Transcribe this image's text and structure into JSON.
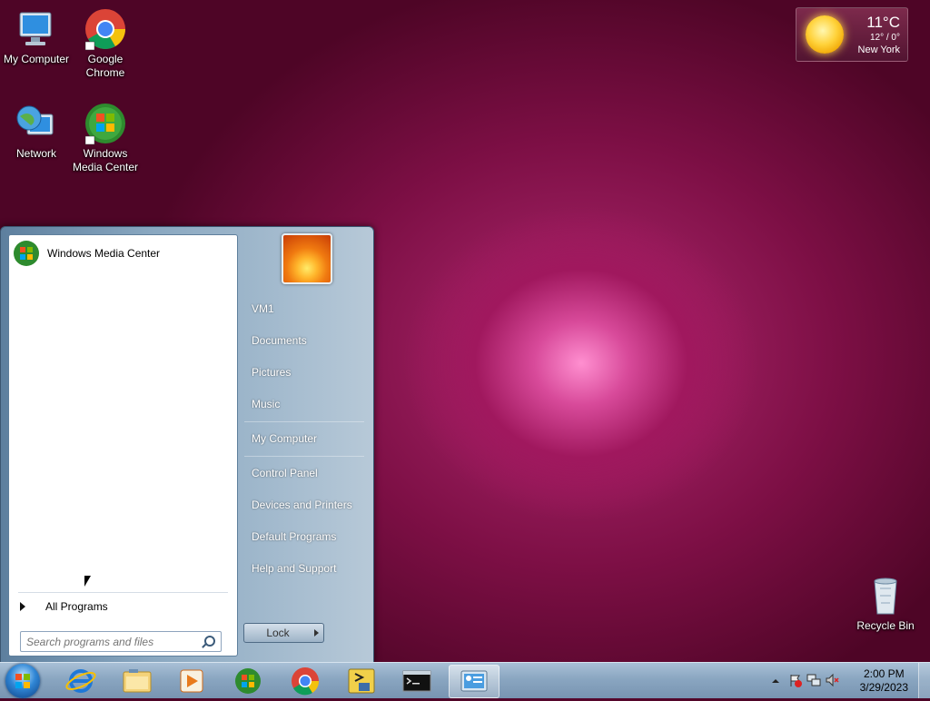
{
  "desktop": {
    "icons": [
      {
        "label": "My Computer",
        "icon": "monitor-icon"
      },
      {
        "label": "Google Chrome",
        "icon": "chrome-icon"
      },
      {
        "label": "Network",
        "icon": "network-globe-icon"
      },
      {
        "label": "Windows Media Center",
        "icon": "windows-media-center-icon"
      },
      {
        "label": "Recycle Bin",
        "icon": "recycle-bin-icon"
      }
    ]
  },
  "weather": {
    "temp": "11°C",
    "range": "12° / 0°",
    "city": "New York",
    "icon": "sun-icon"
  },
  "startmenu": {
    "pinned_program": "Windows Media Center",
    "all_programs": "All Programs",
    "search_placeholder": "Search programs and files",
    "right_items": [
      "VM1",
      "Documents",
      "Pictures",
      "Music",
      "My Computer",
      "Control Panel",
      "Devices and Printers",
      "Default Programs",
      "Help and Support"
    ],
    "lock_label": "Lock"
  },
  "taskbar": {
    "apps": [
      "internet-explorer-icon",
      "file-explorer-icon",
      "media-player-icon",
      "windows-media-center-icon",
      "chrome-icon",
      "python-icon",
      "command-prompt-icon",
      "control-panel-icon"
    ],
    "time": "2:00 PM",
    "date": "3/29/2023"
  }
}
